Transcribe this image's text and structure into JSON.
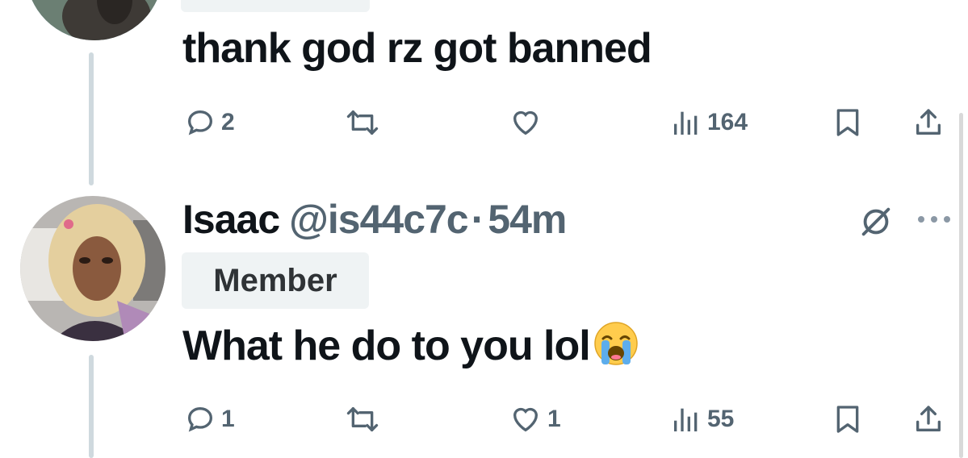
{
  "tweet1": {
    "text": "thank god rz got banned",
    "actions": {
      "replies": "2",
      "reposts": "",
      "likes": "",
      "views": "164"
    }
  },
  "tweet2": {
    "name": "Isaac",
    "handle": "@is44c7c",
    "separator": "·",
    "time": "54m",
    "badge": "Member",
    "text": "What he do to you lol",
    "emoji": "loudly-crying-face",
    "actions": {
      "replies": "1",
      "reposts": "",
      "likes": "1",
      "views": "55"
    }
  },
  "icons": [
    "reply-icon",
    "repost-icon",
    "like-icon",
    "views-icon",
    "bookmark-icon",
    "share-icon",
    "grok-icon",
    "more-icon"
  ],
  "colors": {
    "text": "#0f1419",
    "muted": "#536471",
    "badge_bg": "#eff3f4",
    "thread_line": "#cfd9de"
  }
}
